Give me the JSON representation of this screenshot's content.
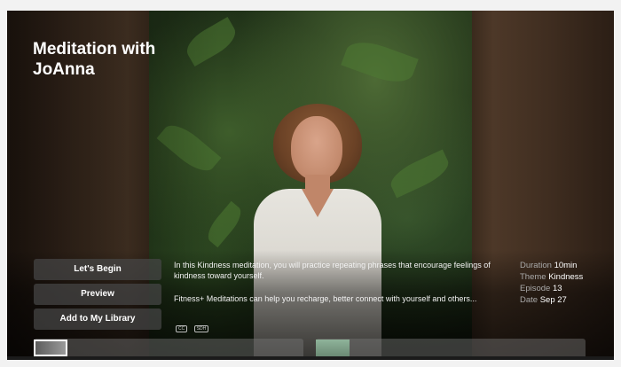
{
  "show": {
    "title": "Meditation with JoAnna"
  },
  "actions": {
    "begin": "Let's Begin",
    "preview": "Preview",
    "add_library": "Add to My Library"
  },
  "description": {
    "line1": "In this Kindness meditation, you will practice repeating phrases that encourage feelings of kindness toward yourself.",
    "line2": "Fitness+ Meditations can help you recharge, better connect with yourself and others..."
  },
  "badges": [
    "CC",
    "SDH"
  ],
  "details": {
    "duration_label": "Duration",
    "duration_value": "10min",
    "theme_label": "Theme",
    "theme_value": "Kindness",
    "episode_label": "Episode",
    "episode_value": "13",
    "date_label": "Date",
    "date_value": "Sep 27"
  }
}
